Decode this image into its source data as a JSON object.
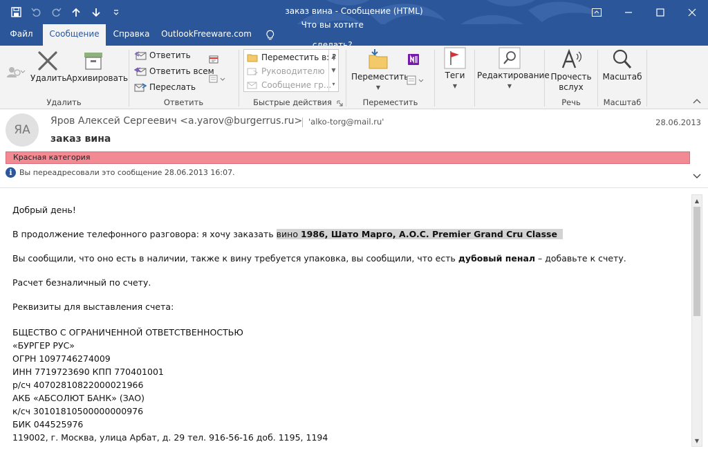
{
  "window": {
    "title": "заказ вина  -  Сообщение (HTML)"
  },
  "tabs": [
    {
      "label": "Файл"
    },
    {
      "label": "Сообщение"
    },
    {
      "label": "Справка"
    },
    {
      "label": "OutlookFreeware.com"
    }
  ],
  "tell_me": "Что вы хотите сделать?",
  "ribbon": {
    "delete_group": {
      "delete": "Удалить",
      "archive": "Архивировать",
      "label": "Удалить"
    },
    "respond_group": {
      "reply": "Ответить",
      "reply_all": "Ответить всем",
      "forward": "Переслать",
      "label": "Ответить"
    },
    "quick_steps": {
      "items": [
        "Переместить в: ?",
        "Руководителю",
        "Сообщение гр..."
      ],
      "label": "Быстрые действия"
    },
    "move_group": {
      "move": "Переместить",
      "label": "Переместить"
    },
    "tags_group": {
      "tags": "Теги"
    },
    "edit_group": {
      "edit": "Редактирование"
    },
    "speech_group": {
      "read_aloud_1": "Прочесть",
      "read_aloud_2": "вслух",
      "label": "Речь"
    },
    "zoom_group": {
      "zoom": "Масштаб",
      "label": "Масштаб"
    }
  },
  "header": {
    "avatar_initials": "ЯА",
    "sender": "Яров Алексей Сергеевич <a.yarov@burgerrus.ru>",
    "recipient": "'alko-torg@mail.ru'",
    "date": "28.06.2013",
    "subject": "заказ вина",
    "category": "Красная категория",
    "info": "Вы переадресовали это сообщение 28.06.2013 16:07."
  },
  "body": {
    "greeting": "Добрый день!",
    "line1_pre": "В продолжение телефонного разговора: я хочу заказать ",
    "line1_hl_plain": "вино ",
    "line1_hl_bold": "1986, Шато Марго, A.O.C. Premier Grand Cru Classe",
    "line2_pre": "Вы сообщили, что оно есть в наличии, также к вину требуется упаковка, вы сообщили, что есть ",
    "line2_bold": "дубовый пенал",
    "line2_post": " – добавьте к счету.",
    "line3": "Расчет безналичный по счету.",
    "line4": "Реквизиты для выставления счета:",
    "requisites": [
      "БЩЕСТВО С ОГРАНИЧЕННОЙ ОТВЕТСТВЕННОСТЬЮ",
      "«БУРГЕР РУС»",
      "ОГРН 1097746274009",
      "ИНН 7719723690 КПП 770401001",
      "р/сч 40702810822000021966",
      "АКБ «АБСОЛЮТ БАНК» (ЗАО)",
      "к/сч 30101810500000000976",
      "БИК 044525976",
      "119002, г. Москва, улица Арбат, д. 29 тел. 916-56-16 доб. 1195, 1194"
    ]
  },
  "colors": {
    "titlebar": "#2b579a",
    "ribbon": "#f3f3f3",
    "category": "#f28a93",
    "highlight": "#d3d3d3"
  }
}
